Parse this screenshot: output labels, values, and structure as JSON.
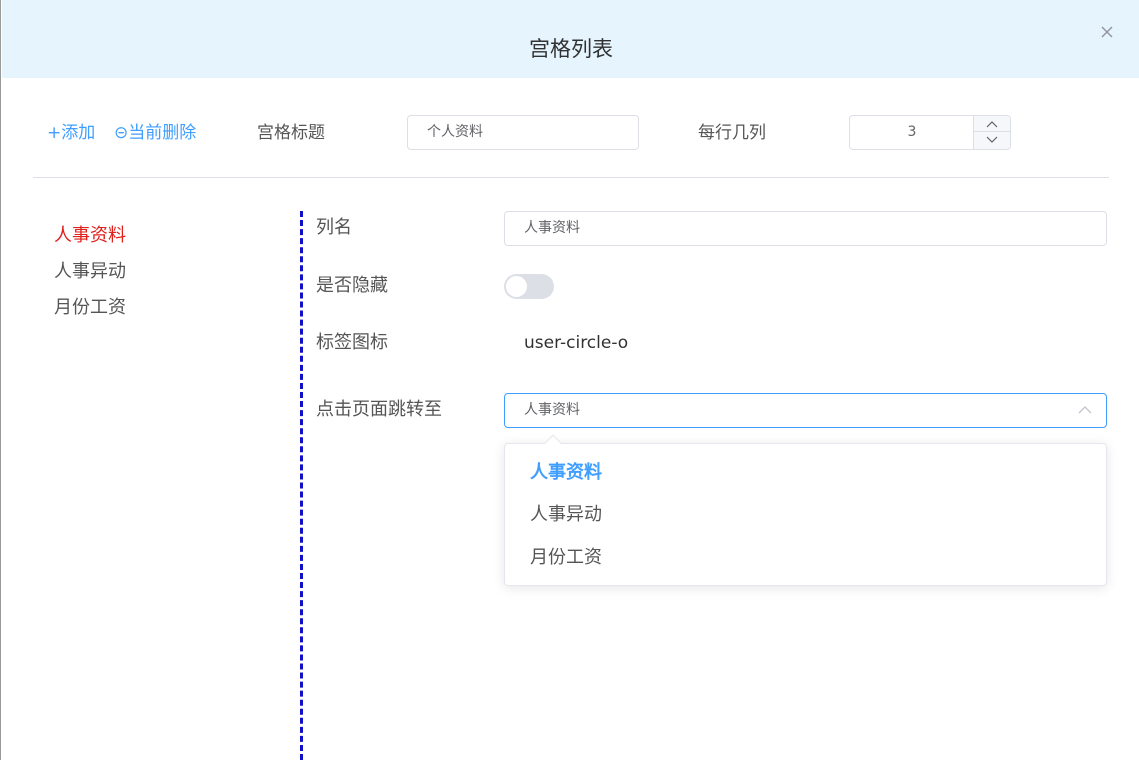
{
  "dialog": {
    "title": "宫格列表",
    "close_icon": "close-icon"
  },
  "toolbar": {
    "add_label": "+添加",
    "delete_label": "⊝当前删除",
    "grid_title_label": "宫格标题",
    "grid_title_value": "个人资料",
    "columns_label": "每行几列",
    "columns_value": "3"
  },
  "sidebar": {
    "items": [
      {
        "label": "人事资料",
        "active": true
      },
      {
        "label": "人事异动",
        "active": false
      },
      {
        "label": "月份工资",
        "active": false
      }
    ]
  },
  "form": {
    "col_name_label": "列名",
    "col_name_value": "人事资料",
    "hidden_label": "是否隐藏",
    "hidden_value": false,
    "tag_icon_label": "标签图标",
    "tag_icon_value": "user-circle-o",
    "jump_label": "点击页面跳转至",
    "jump_value": "人事资料",
    "jump_options": [
      "人事资料",
      "人事异动",
      "月份工资"
    ]
  },
  "colors": {
    "accent": "#409eff",
    "active_item": "#e0201b",
    "header_bg": "#e6f4fd",
    "divider_line": "#1010c8"
  }
}
